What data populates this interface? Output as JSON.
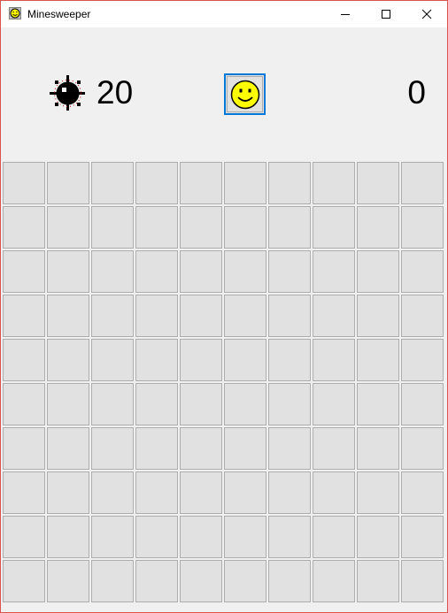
{
  "window": {
    "title": "Minesweeper"
  },
  "status": {
    "mine_count": "20",
    "timer": "0",
    "face": "smiley-face-icon"
  },
  "board": {
    "rows": 10,
    "cols": 10,
    "cells": "unrevealed"
  },
  "colors": {
    "accent": "#0078d7",
    "cell": "#e1e1e1",
    "cell_border": "#adadad",
    "background": "#f0f0f0",
    "face": "#ffff00"
  }
}
